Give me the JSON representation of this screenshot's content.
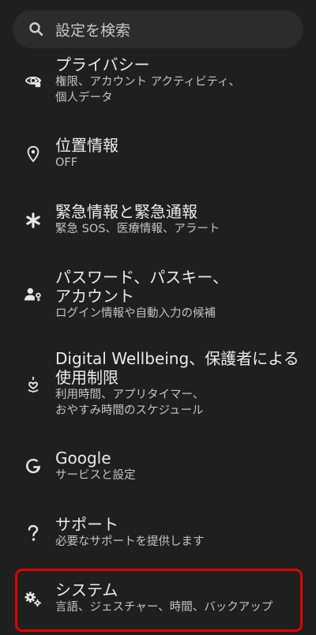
{
  "search": {
    "placeholder": "設定を検索",
    "icon": "search-icon"
  },
  "items": [
    {
      "icon": "privacy-eye-icon",
      "title": "プライバシー",
      "sub_lines": [
        "権限、アカウント アクティビティ、",
        "個人データ"
      ]
    },
    {
      "icon": "location-pin-icon",
      "title": "位置情報",
      "sub_lines": [
        "OFF"
      ]
    },
    {
      "icon": "asterisk-icon",
      "title": "緊急情報と緊急通報",
      "sub_lines": [
        "緊急 SOS、医療情報、アラート"
      ]
    },
    {
      "icon": "person-key-icon",
      "title_lines": [
        "パスワード、パスキー、",
        "アカウント"
      ],
      "sub_lines": [
        "ログイン情報や自動入力の候補"
      ]
    },
    {
      "icon": "wellbeing-heart-icon",
      "title_lines": [
        "Digital Wellbeing、保護者による",
        "使用制限"
      ],
      "sub_lines": [
        "利用時間、アプリタイマー、",
        "おやすみ時間のスケジュール"
      ]
    },
    {
      "icon": "google-g-icon",
      "title": "Google",
      "sub_lines": [
        "サービスと設定"
      ]
    },
    {
      "icon": "help-question-icon",
      "title": "サポート",
      "sub_lines": [
        "必要なサポートを提供します"
      ]
    },
    {
      "icon": "system-gears-icon",
      "title": "システム",
      "sub_lines": [
        "言語、ジェスチャー、時間、バックアップ"
      ]
    }
  ],
  "colors": {
    "background": "#1f1f1f",
    "search_bg": "#2c2c2c",
    "highlight": "#e00000"
  }
}
